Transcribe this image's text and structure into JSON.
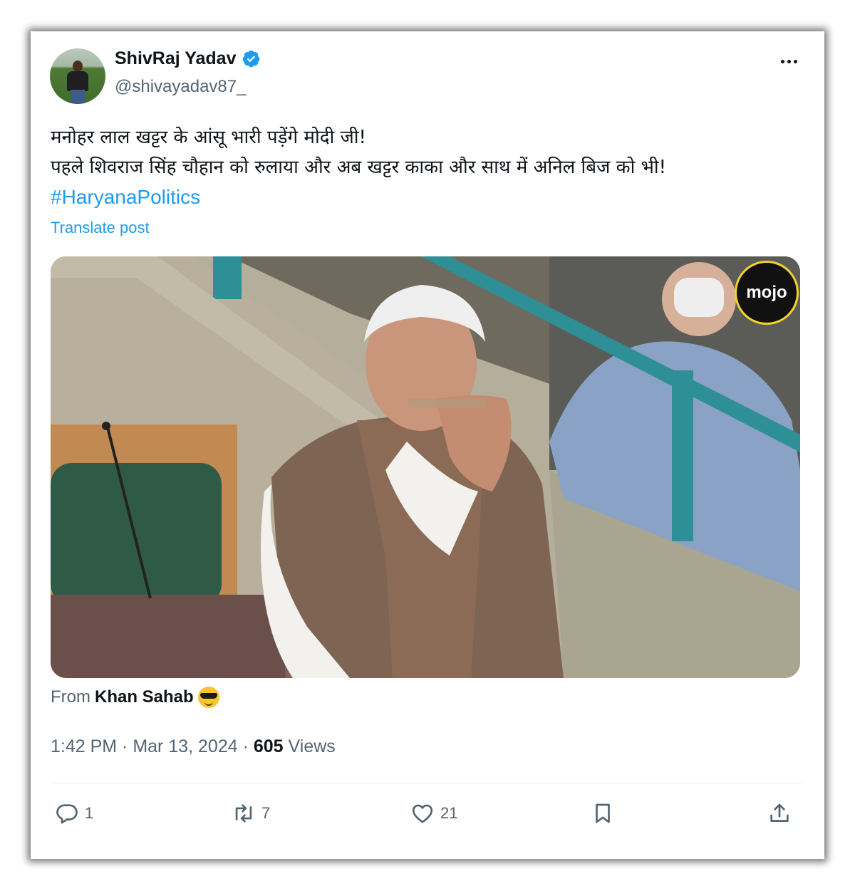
{
  "author": {
    "name": "ShivRaj Yadav",
    "handle": "@shivayadav87_"
  },
  "icons": {
    "verified": "verified-badge-icon",
    "more": "more-options-icon",
    "reply": "reply-icon",
    "retweet": "retweet-icon",
    "like": "like-icon",
    "bookmark": "bookmark-icon",
    "share": "share-icon"
  },
  "colors": {
    "accent": "#1d9bf0",
    "text": "#0f1419",
    "muted": "#536471"
  },
  "tweet": {
    "line1": "मनोहर लाल खट्टर के आंसू भारी पड़ेंगे मोदी जी!",
    "line2": "पहले शिवराज सिंह चौहान को रुलाया और अब खट्टर काका और साथ में अनिल बिज को भी!",
    "hashtag": "#HaryanaPolitics",
    "translate": "Translate post"
  },
  "media": {
    "watermark": "mojo"
  },
  "source": {
    "prefix": "From",
    "name": "Khan Sahab"
  },
  "meta": {
    "time": "1:42 PM",
    "sep1": " · ",
    "date": "Mar 13, 2024",
    "sep2": " · ",
    "views": "605",
    "views_label": " Views"
  },
  "stats": {
    "replies": "1",
    "retweets": "7",
    "likes": "21"
  }
}
